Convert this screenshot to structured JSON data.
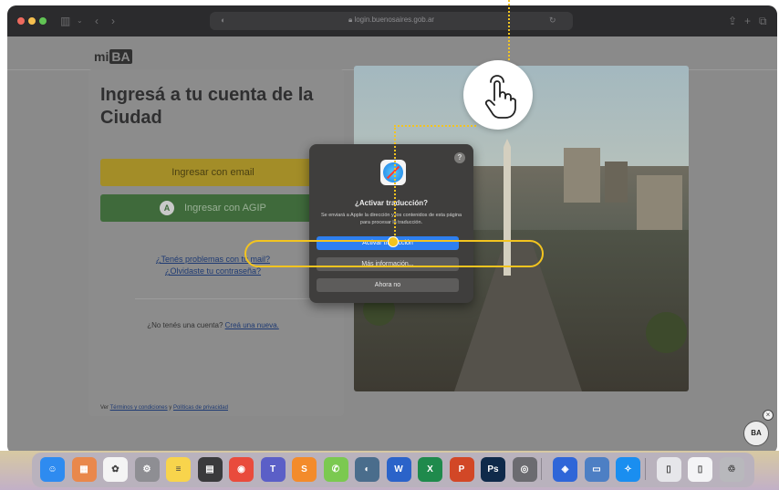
{
  "browser": {
    "url": "login.buenosaires.gob.ar"
  },
  "site": {
    "logo_prefix": "mi",
    "logo_box": "BA"
  },
  "login": {
    "title": "Ingresá a tu cuenta de la Ciudad",
    "email_button": "Ingresar con email",
    "agip_badge": "A",
    "agip_button": "Ingresar con AGIP",
    "link_problems": "¿Tenés problemas con tu mail?",
    "link_forgot": "¿Olvidaste tu contraseña?",
    "no_account": "¿No tenés una cuenta?",
    "create_link": "Creá una nueva.",
    "terms_prefix": "Ver",
    "terms_link": "Términos y condiciones",
    "terms_and": "y",
    "privacy_link": "Políticas de privacidad"
  },
  "popup": {
    "help": "?",
    "title": "¿Activar traducción?",
    "body": "Se enviará a Apple la dirección y los contenidos de esta página para procesar la traducción.",
    "primary": "Activar traducción",
    "more": "Más información...",
    "dismiss": "Ahora no"
  },
  "corner": {
    "ba_label": "BA",
    "close": "×"
  },
  "colors": {
    "accent": "#f3c41f",
    "translate_button": "#2d7ff0"
  },
  "dock": [
    {
      "name": "finder-icon",
      "glyph": "☺",
      "color": "#2e8bf0"
    },
    {
      "name": "launchpad-icon",
      "glyph": "▦",
      "color": "#e9884c"
    },
    {
      "name": "photos-icon",
      "glyph": "✿",
      "color": "#f4f4f4"
    },
    {
      "name": "system-settings-icon",
      "glyph": "⚙",
      "color": "#8e8e93"
    },
    {
      "name": "notes-icon",
      "glyph": "≡",
      "color": "#f8d44c"
    },
    {
      "name": "calculator-icon",
      "glyph": "▤",
      "color": "#3a3a3c"
    },
    {
      "name": "chrome-icon",
      "glyph": "◉",
      "color": "#e94b3c"
    },
    {
      "name": "teams-icon",
      "glyph": "T",
      "color": "#5b5fc7"
    },
    {
      "name": "sublime-icon",
      "glyph": "S",
      "color": "#f38b2b"
    },
    {
      "name": "whatsapp-icon",
      "glyph": "✆",
      "color": "#7bc950"
    },
    {
      "name": "preview-icon",
      "glyph": "◐",
      "color": "#4a6d8c"
    },
    {
      "name": "word-icon",
      "glyph": "W",
      "color": "#2b63c9"
    },
    {
      "name": "excel-icon",
      "glyph": "X",
      "color": "#1f8a4c"
    },
    {
      "name": "powerpoint-icon",
      "glyph": "P",
      "color": "#d24726"
    },
    {
      "name": "photoshop-icon",
      "glyph": "Ps",
      "color": "#0f2a4a"
    },
    {
      "name": "screenshot-icon",
      "glyph": "◎",
      "color": "#6b6b70"
    },
    {
      "name": "security-icon",
      "glyph": "◈",
      "color": "#2f66d8"
    },
    {
      "name": "scanner-icon",
      "glyph": "▭",
      "color": "#4d7fc4"
    },
    {
      "name": "safari-icon",
      "glyph": "✧",
      "color": "#1a8ef0"
    },
    {
      "name": "files-icon",
      "glyph": "▯",
      "color": "#e6e6ea"
    },
    {
      "name": "document-icon",
      "glyph": "▯",
      "color": "#f4f4f6"
    },
    {
      "name": "trash-icon",
      "glyph": "♲",
      "color": "#b8b8bc"
    }
  ]
}
